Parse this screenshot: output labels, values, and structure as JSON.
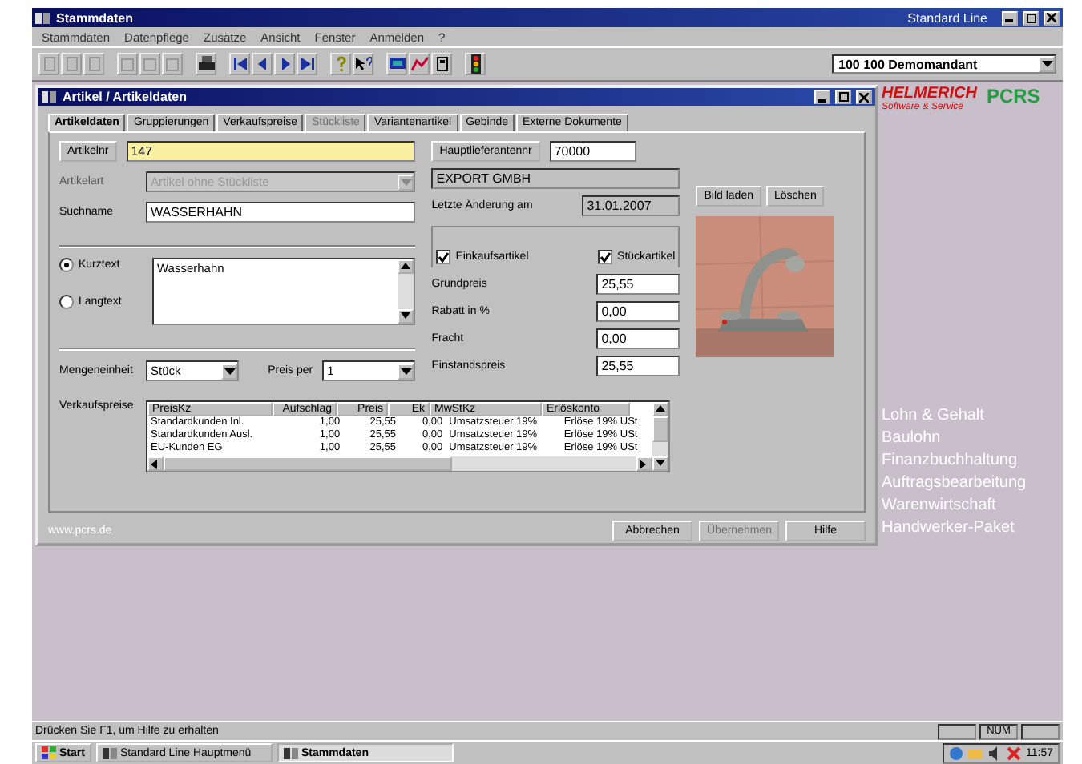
{
  "window": {
    "title": "Stammdaten",
    "edition": "Standard Line"
  },
  "menu": [
    "Stammdaten",
    "Datenpflege",
    "Zusätze",
    "Ansicht",
    "Fenster",
    "Anmelden",
    "?"
  ],
  "toolbar": {
    "client": "100  100 Demomandant"
  },
  "child": {
    "title": "Artikel / Artikeldaten",
    "tabs": [
      {
        "label": "Artikeldaten",
        "selected": true,
        "disabled": false
      },
      {
        "label": "Gruppierungen",
        "selected": false,
        "disabled": false
      },
      {
        "label": "Verkaufspreise",
        "selected": false,
        "disabled": false
      },
      {
        "label": "Stückliste",
        "selected": false,
        "disabled": true
      },
      {
        "label": "Variantenartikel",
        "selected": false,
        "disabled": false
      },
      {
        "label": "Gebinde",
        "selected": false,
        "disabled": false
      },
      {
        "label": "Externe Dokumente",
        "selected": false,
        "disabled": false
      }
    ],
    "article_button": "Artikelnr",
    "article_no": "147",
    "type_label": "Artikelart",
    "type_value": "Artikel ohne Stückliste",
    "search_label": "Suchname",
    "search_value": "WASSERHAHN",
    "supplier_button": "Hauptlieferantennr",
    "supplier_no": "70000",
    "supplier_name": "EXPORT GMBH",
    "changed_label": "Letzte Änderung am",
    "changed_value": "31.01.2007",
    "text_options": [
      {
        "label": "Kurztext",
        "selected": true
      },
      {
        "label": "Langtext",
        "selected": false
      }
    ],
    "text_value": "Wasserhahn",
    "flags": [
      {
        "label": "Einkaufsartikel",
        "checked": true
      },
      {
        "label": "Stückartikel",
        "checked": true
      }
    ],
    "prices": [
      {
        "label": "Grundpreis",
        "value": "25,55"
      },
      {
        "label": "Rabatt in %",
        "value": "0,00"
      },
      {
        "label": "Fracht",
        "value": "0,00"
      },
      {
        "label": "Einstandspreis",
        "value": "25,55"
      }
    ],
    "unit_label": "Mengeneinheit",
    "unit_value": "Stück",
    "per_label": "Preis per",
    "per_value": "1",
    "image_buttons": [
      "Bild laden",
      "Löschen"
    ],
    "sales_label": "Verkaufspreise",
    "table": {
      "columns": [
        "PreisKz",
        "Aufschlag",
        "Preis",
        "Ek",
        "MwStKz",
        "Erlöskonto"
      ],
      "rows": [
        [
          "Standardkunden Inl.",
          "1,00",
          "25,55",
          "0,00",
          "Umsatzsteuer 19%",
          "Erlöse 19% USt"
        ],
        [
          "Standardkunden Ausl.",
          "1,00",
          "25,55",
          "0,00",
          "Umsatzsteuer 19%",
          "Erlöse 19% USt"
        ],
        [
          "EU-Kunden EG",
          "1,00",
          "25,55",
          "0,00",
          "Umsatzsteuer 19%",
          "Erlöse 19% USt"
        ]
      ]
    },
    "website": "www.pcrs.de",
    "buttons": [
      {
        "label": "Abbrechen",
        "disabled": false
      },
      {
        "label": "Übernehmen",
        "disabled": true
      },
      {
        "label": "Hilfe",
        "disabled": false
      }
    ]
  },
  "brand": {
    "name": "HELMERICH",
    "tagline": "Software & Service",
    "mark": "PCRS"
  },
  "products": [
    "Lohn & Gehalt",
    "Baulohn",
    "Finanzbuchhaltung",
    "Auftragsbearbeitung",
    "Warenwirtschaft",
    "Handwerker-Paket"
  ],
  "status_bar": {
    "text": "Drücken Sie F1, um Hilfe zu erhalten",
    "num": "NUM"
  },
  "taskbar": {
    "start": "Start",
    "tasks": [
      {
        "label": "Standard Line Hauptmenü",
        "selected": false
      },
      {
        "label": "Stammdaten",
        "selected": true
      }
    ],
    "clock": "11:57"
  }
}
